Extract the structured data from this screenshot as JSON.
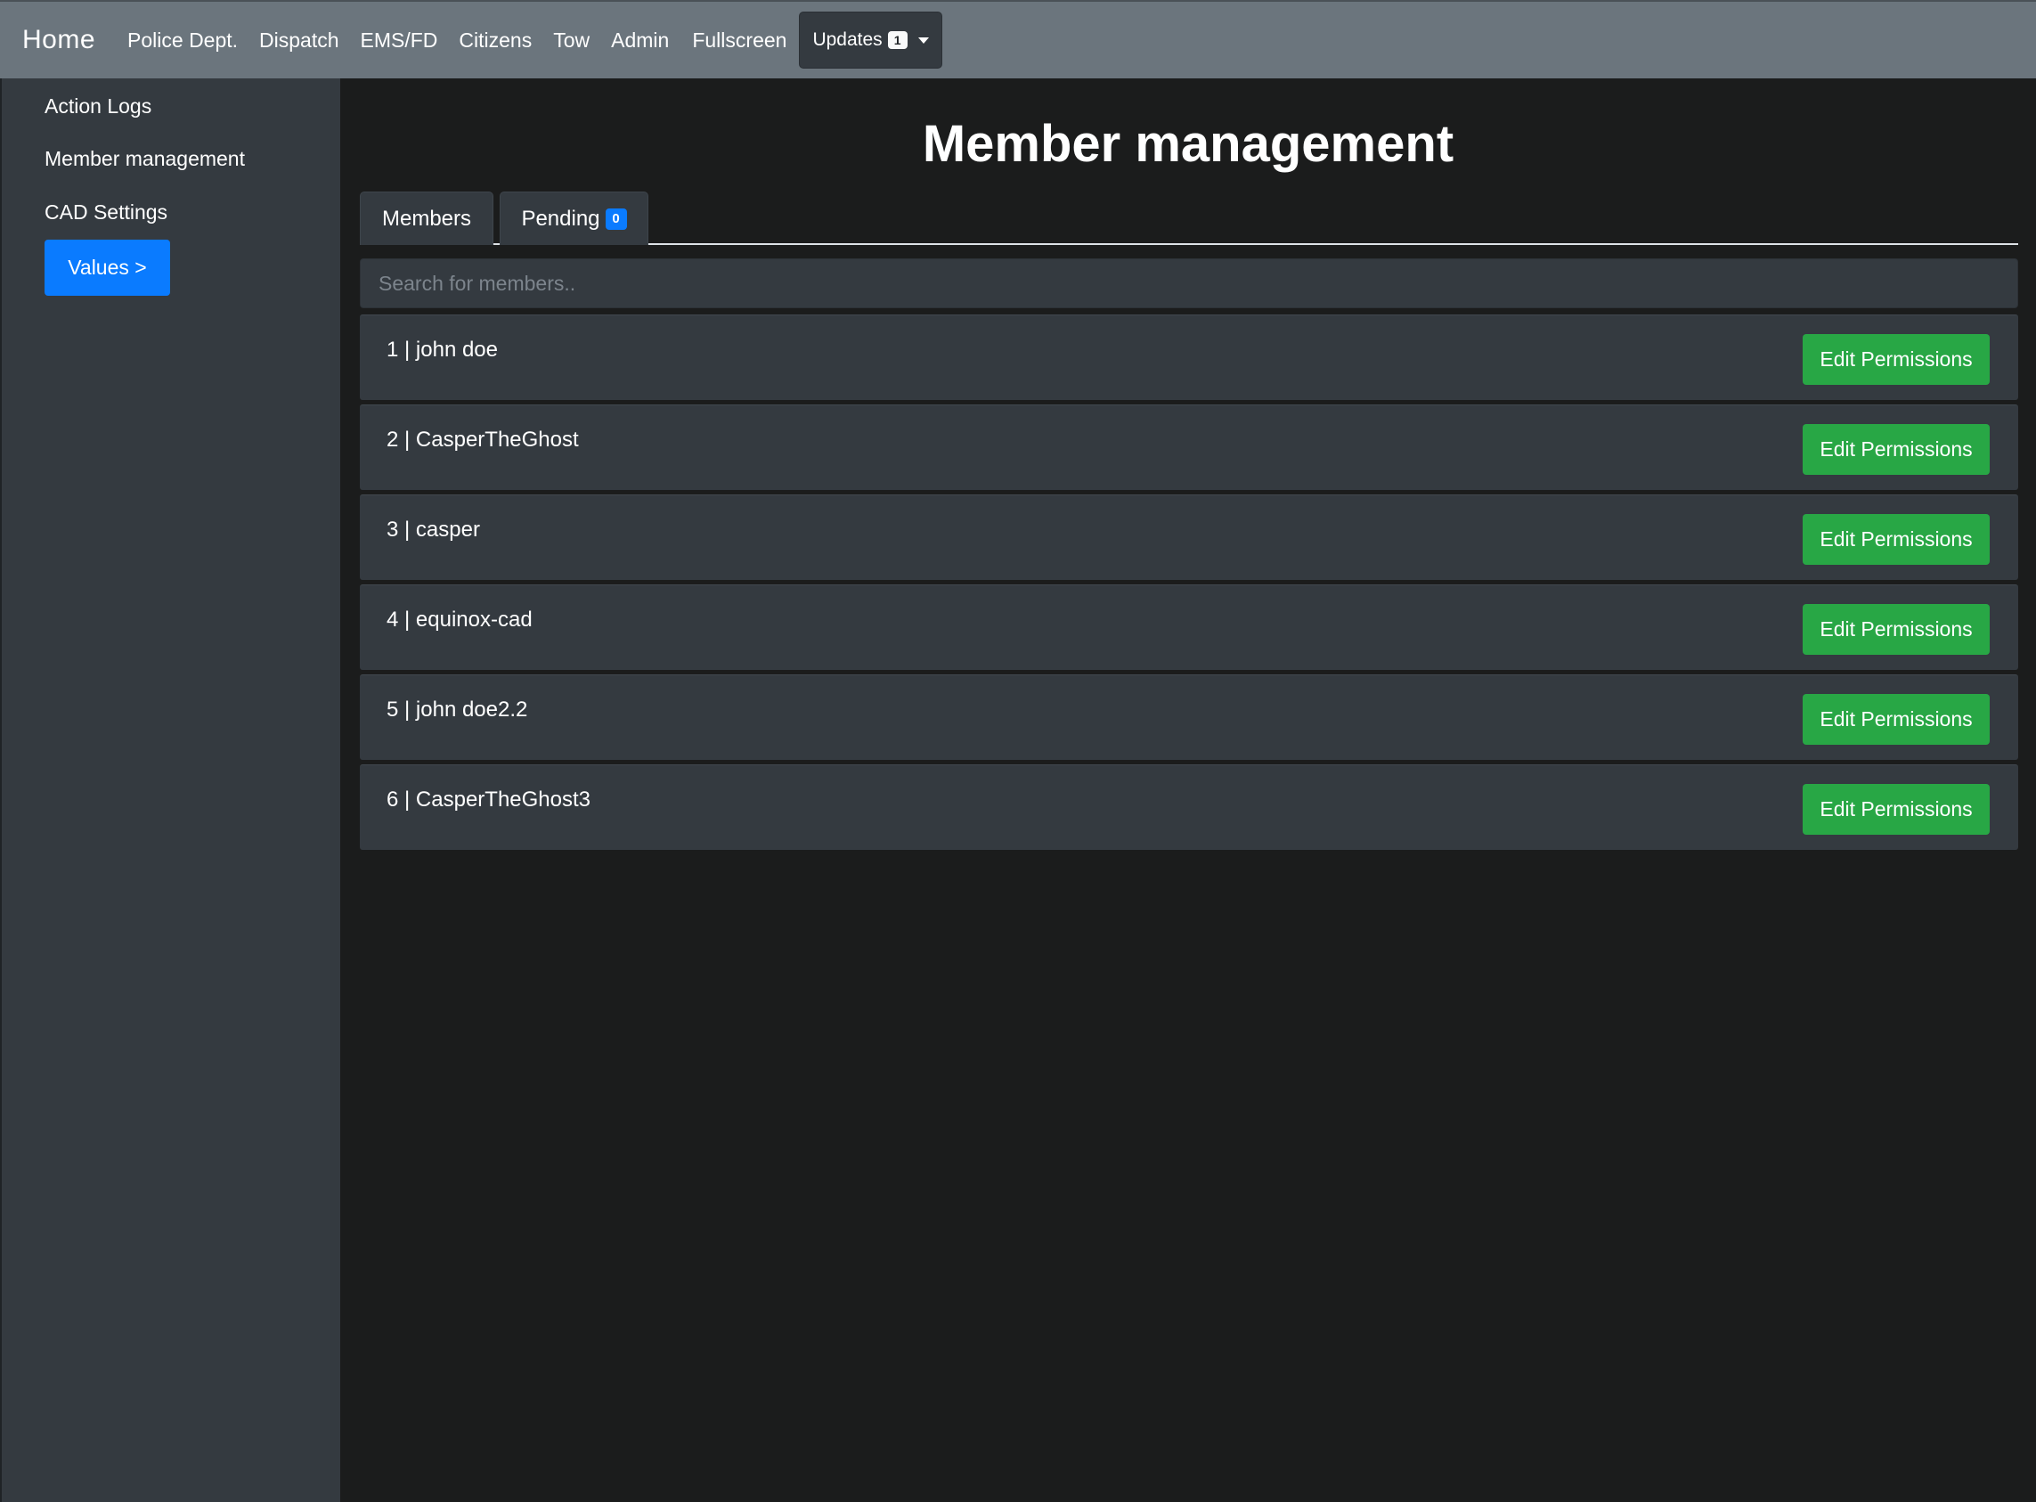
{
  "navbar": {
    "brand": "Home",
    "links": [
      "Police Dept.",
      "Dispatch",
      "EMS/FD",
      "Citizens",
      "Tow",
      "Admin",
      "Fullscreen"
    ],
    "updates_label": "Updates",
    "updates_count": "1"
  },
  "sidebar": {
    "items": [
      "Action Logs",
      "Member management",
      "CAD Settings"
    ],
    "values_button": "Values >"
  },
  "main": {
    "title": "Member management",
    "tabs": {
      "members": "Members",
      "pending": "Pending",
      "pending_count": "0"
    },
    "search_placeholder": "Search for members..",
    "members": [
      {
        "label": "1 | john doe",
        "action": "Edit Permissions"
      },
      {
        "label": "2 | CasperTheGhost",
        "action": "Edit Permissions"
      },
      {
        "label": "3 | casper",
        "action": "Edit Permissions"
      },
      {
        "label": "4 | equinox-cad",
        "action": "Edit Permissions"
      },
      {
        "label": "5 | john doe2.2",
        "action": "Edit Permissions"
      },
      {
        "label": "6 | CasperTheGhost3",
        "action": "Edit Permissions"
      }
    ]
  },
  "colors": {
    "navbar": "#6b757d",
    "sidebar": "#343a40",
    "background": "#1b1c1c",
    "primary": "#0a7bff",
    "success": "#28a745"
  }
}
